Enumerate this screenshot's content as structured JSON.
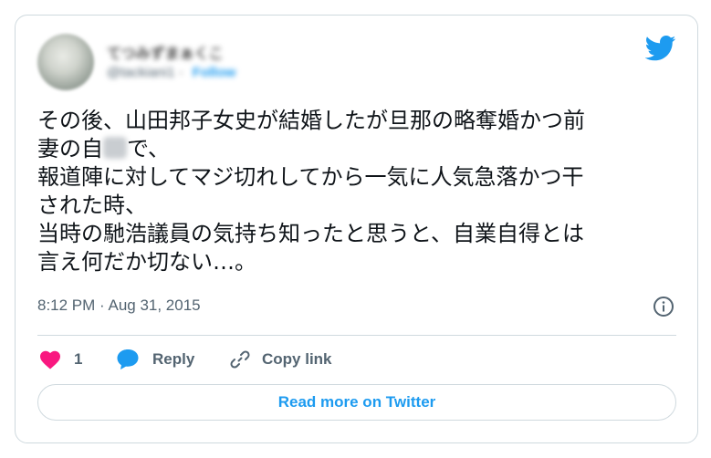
{
  "author": {
    "name": "てつみずまぁくこ",
    "handle": "@tackiani1",
    "follow_label": "Follow"
  },
  "tweet": {
    "lines": [
      "その後、山田邦子女史が結婚したが旦那の略奪婚かつ前",
      "妻の自",
      "で、",
      "報道陣に対してマジ切れしてから一気に人気急落かつ干",
      "された時、",
      "当時の馳浩議員の気持ち知ったと思うと、自業自得とは",
      "言え何だか切ない…。"
    ]
  },
  "timestamp": "8:12 PM · Aug 31, 2015",
  "actions": {
    "like_count": "1",
    "reply_label": "Reply",
    "copy_link_label": "Copy link"
  },
  "read_more_label": "Read more on Twitter",
  "colors": {
    "twitter_blue": "#1d9bf0",
    "like_pink": "#f91880",
    "border": "#cfd9de",
    "muted_text": "#536471"
  }
}
